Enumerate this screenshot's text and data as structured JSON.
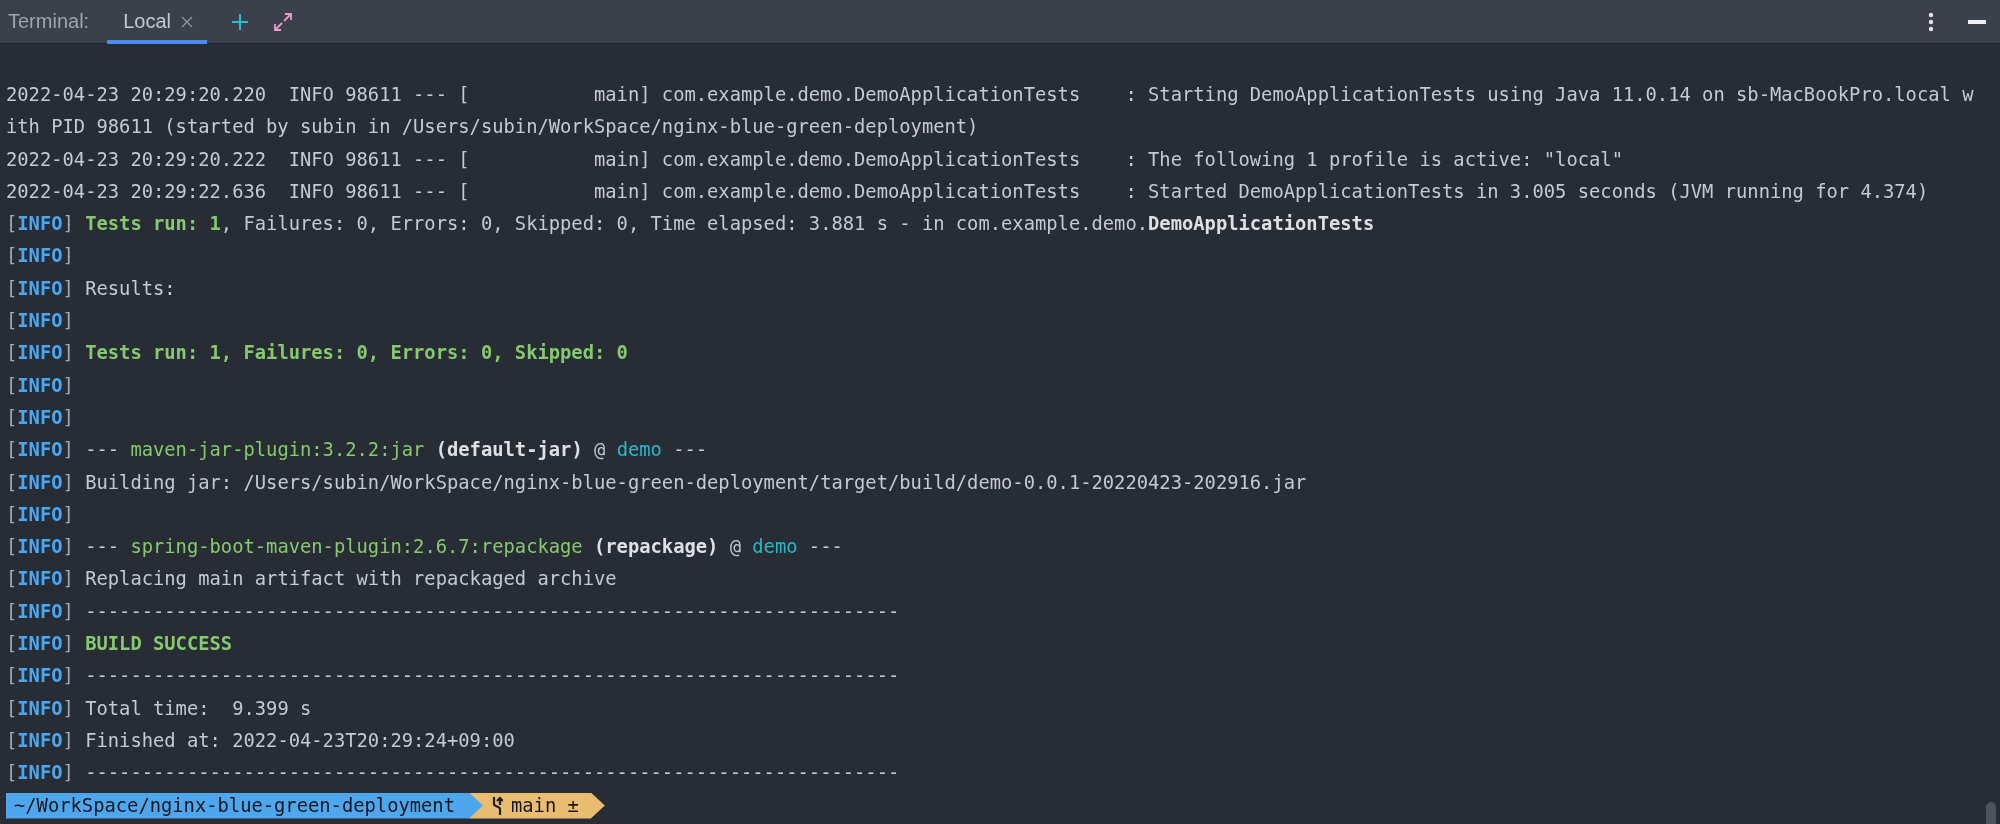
{
  "toolbar": {
    "title": "Terminal:",
    "tabs": [
      {
        "label": "Local",
        "selected": true
      }
    ]
  },
  "lines": [
    {
      "segments": [
        {
          "kind": "text",
          "text": "2022-04-23 20:29:20.220  INFO 98611 --- [           main] com.example.demo.DemoApplicationTests    : Starting DemoApplicationTests using Java 11.0.14 on sb-MacBookPro.local w"
        }
      ]
    },
    {
      "segments": [
        {
          "kind": "text",
          "text": "ith PID 98611 (started by subin in /Users/subin/WorkSpace/nginx-blue-green-deployment)"
        }
      ]
    },
    {
      "segments": [
        {
          "kind": "text",
          "text": "2022-04-23 20:29:20.222  INFO 98611 --- [           main] com.example.demo.DemoApplicationTests    : The following 1 profile is active: \"local\""
        }
      ]
    },
    {
      "segments": [
        {
          "kind": "text",
          "text": "2022-04-23 20:29:22.636  INFO 98611 --- [           main] com.example.demo.DemoApplicationTests    : Started DemoApplicationTests in 3.005 seconds (JVM running for 4.374)"
        }
      ]
    },
    {
      "prefix": "[INFO]",
      "segments": [
        {
          "kind": "green-bold",
          "text": "Tests run: 1"
        },
        {
          "kind": "text",
          "text": ", Failures: 0, Errors: 0, Skipped: 0, Time elapsed: 3.881 s - in com.example.demo."
        },
        {
          "kind": "bold",
          "text": "DemoApplicationTests"
        }
      ]
    },
    {
      "prefix": "[INFO]"
    },
    {
      "prefix": "[INFO]",
      "segments": [
        {
          "kind": "text",
          "text": "Results:"
        }
      ]
    },
    {
      "prefix": "[INFO]"
    },
    {
      "prefix": "[INFO]",
      "segments": [
        {
          "kind": "green-bold",
          "text": "Tests run: 1, Failures: 0, Errors: 0, Skipped: 0"
        }
      ]
    },
    {
      "prefix": "[INFO]"
    },
    {
      "prefix": "[INFO]"
    },
    {
      "prefix": "[INFO]",
      "segments": [
        {
          "kind": "text",
          "text": "--- "
        },
        {
          "kind": "green",
          "text": "maven-jar-plugin:3.2.2:jar"
        },
        {
          "kind": "bold",
          "text": " (default-jar)"
        },
        {
          "kind": "text",
          "text": " @ "
        },
        {
          "kind": "cyan",
          "text": "demo"
        },
        {
          "kind": "text",
          "text": " ---"
        }
      ]
    },
    {
      "prefix": "[INFO]",
      "segments": [
        {
          "kind": "text",
          "text": "Building jar: /Users/subin/WorkSpace/nginx-blue-green-deployment/target/build/demo-0.0.1-20220423-202916.jar"
        }
      ]
    },
    {
      "prefix": "[INFO]"
    },
    {
      "prefix": "[INFO]",
      "segments": [
        {
          "kind": "text",
          "text": "--- "
        },
        {
          "kind": "green",
          "text": "spring-boot-maven-plugin:2.6.7:repackage"
        },
        {
          "kind": "bold",
          "text": " (repackage)"
        },
        {
          "kind": "text",
          "text": " @ "
        },
        {
          "kind": "cyan",
          "text": "demo"
        },
        {
          "kind": "text",
          "text": " ---"
        }
      ]
    },
    {
      "prefix": "[INFO]",
      "segments": [
        {
          "kind": "text",
          "text": "Replacing main artifact with repackaged archive"
        }
      ]
    },
    {
      "prefix": "[INFO]",
      "segments": [
        {
          "kind": "text",
          "text": "------------------------------------------------------------------------"
        }
      ]
    },
    {
      "prefix": "[INFO]",
      "segments": [
        {
          "kind": "green-bold",
          "text": "BUILD SUCCESS"
        }
      ]
    },
    {
      "prefix": "[INFO]",
      "segments": [
        {
          "kind": "text",
          "text": "------------------------------------------------------------------------"
        }
      ]
    },
    {
      "prefix": "[INFO]",
      "segments": [
        {
          "kind": "text",
          "text": "Total time:  9.399 s"
        }
      ]
    },
    {
      "prefix": "[INFO]",
      "segments": [
        {
          "kind": "text",
          "text": "Finished at: 2022-04-23T20:29:24+09:00"
        }
      ]
    },
    {
      "prefix": "[INFO]",
      "segments": [
        {
          "kind": "text",
          "text": "------------------------------------------------------------------------"
        }
      ]
    }
  ],
  "prompt": {
    "path": "~/WorkSpace/nginx-blue-green-deployment",
    "branch": "main ±"
  }
}
